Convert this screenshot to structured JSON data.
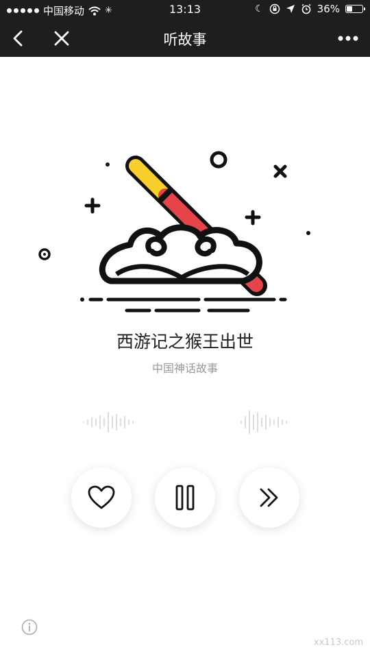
{
  "status_bar": {
    "carrier": "中国移动",
    "time": "13:13",
    "battery_percent": "36%",
    "battery_level": 0.36,
    "icons": [
      "signal-dots-icon",
      "wifi-icon",
      "loading-icon",
      "moon-icon",
      "orientation-lock-icon",
      "location-icon",
      "alarm-icon",
      "battery-icon"
    ]
  },
  "nav": {
    "title": "听故事",
    "icons": [
      "back-chevron-icon",
      "close-icon",
      "more-icon"
    ]
  },
  "story": {
    "title": "西游记之猴王出世",
    "category": "中国神话故事"
  },
  "controls": {
    "icons": [
      "heart-icon",
      "pause-icon",
      "fast-forward-icon"
    ]
  },
  "footer": {
    "watermark": "xx113.com",
    "icon": "info-icon"
  },
  "colors": {
    "bar": "#1e1e1e",
    "staff_yellow": "#f7d02c",
    "staff_red": "#e5454a",
    "text": "#222222",
    "subtext": "#999999"
  }
}
